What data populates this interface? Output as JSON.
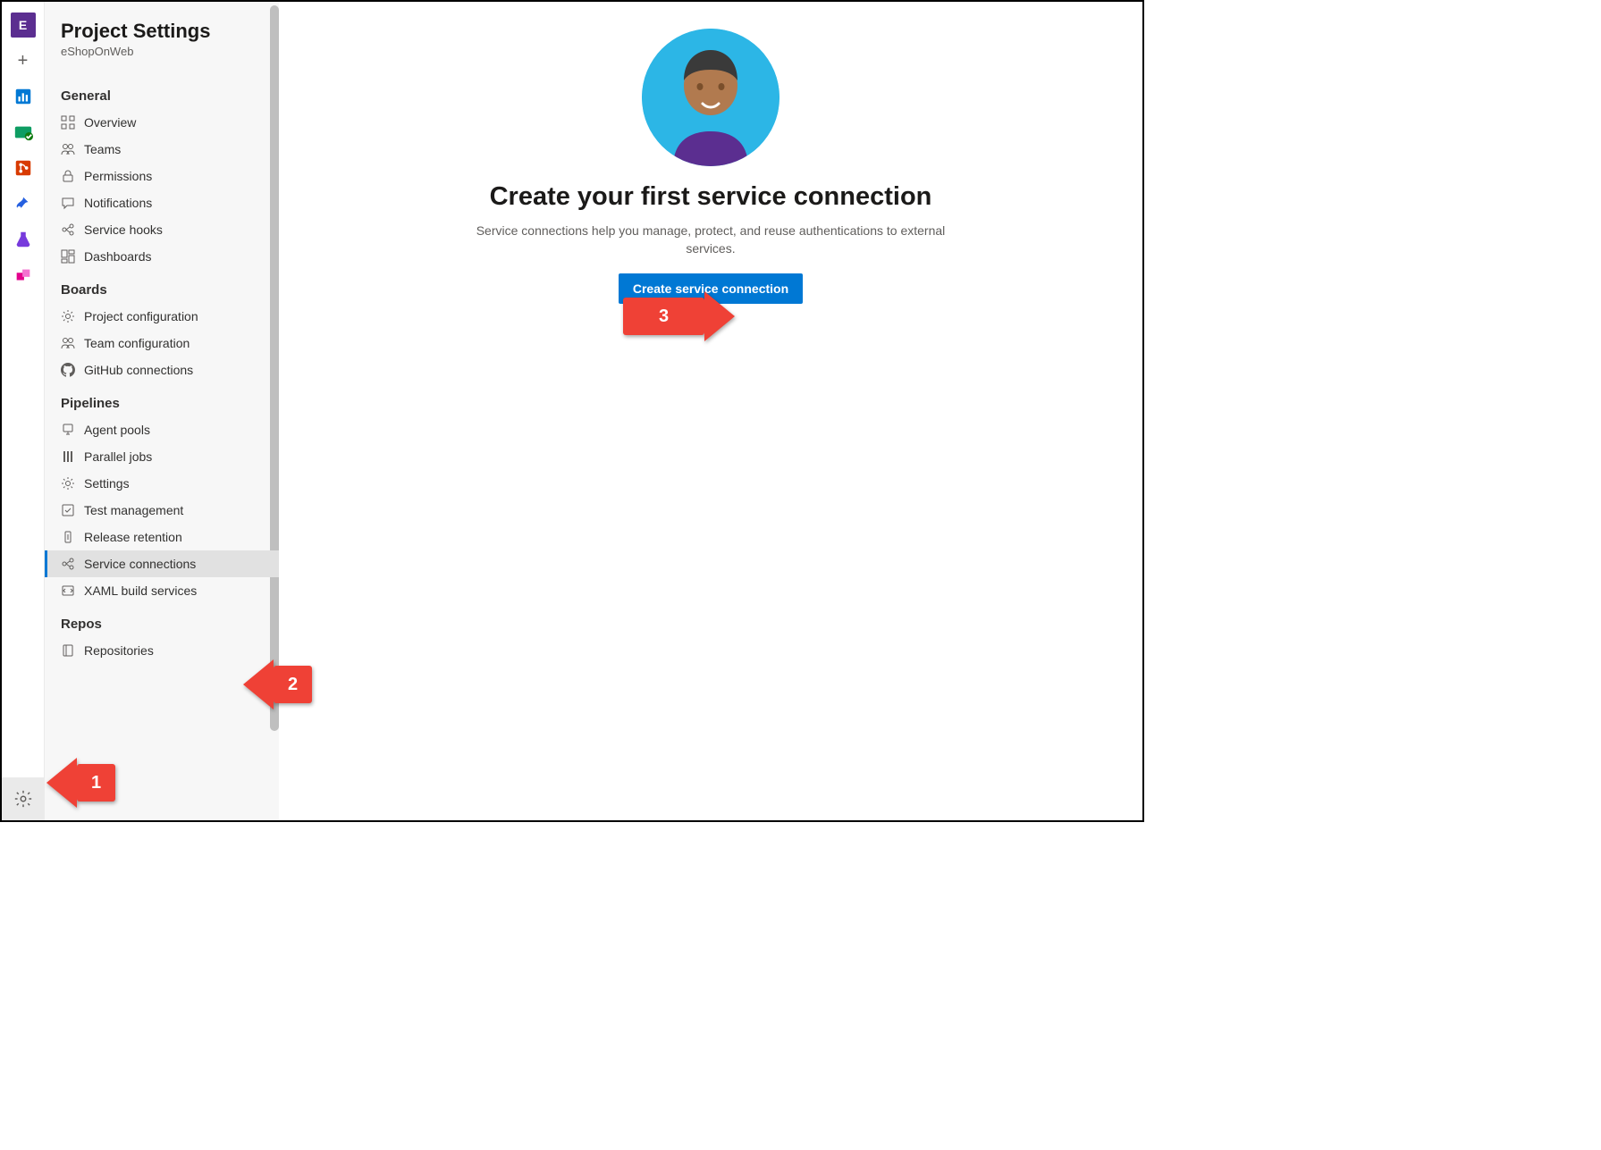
{
  "rail": {
    "project_initial": "E",
    "items": [
      {
        "name": "overview",
        "color": "#0078d4"
      },
      {
        "name": "boards",
        "color": "#107c10"
      },
      {
        "name": "repos",
        "color": "#d83b01"
      },
      {
        "name": "pipelines",
        "color": "#2560e0"
      },
      {
        "name": "test-plans",
        "color": "#773adc"
      },
      {
        "name": "artifacts",
        "color": "#e3008c"
      }
    ]
  },
  "settings": {
    "title": "Project Settings",
    "subtitle": "eShopOnWeb",
    "sections": [
      {
        "title": "General",
        "items": [
          {
            "label": "Overview",
            "icon": "grid"
          },
          {
            "label": "Teams",
            "icon": "teams"
          },
          {
            "label": "Permissions",
            "icon": "lock"
          },
          {
            "label": "Notifications",
            "icon": "chat"
          },
          {
            "label": "Service hooks",
            "icon": "hook"
          },
          {
            "label": "Dashboards",
            "icon": "dashboard"
          }
        ]
      },
      {
        "title": "Boards",
        "items": [
          {
            "label": "Project configuration",
            "icon": "gear2"
          },
          {
            "label": "Team configuration",
            "icon": "teams"
          },
          {
            "label": "GitHub connections",
            "icon": "github"
          }
        ]
      },
      {
        "title": "Pipelines",
        "items": [
          {
            "label": "Agent pools",
            "icon": "agent"
          },
          {
            "label": "Parallel jobs",
            "icon": "parallel"
          },
          {
            "label": "Settings",
            "icon": "gear"
          },
          {
            "label": "Test management",
            "icon": "test"
          },
          {
            "label": "Release retention",
            "icon": "release"
          },
          {
            "label": "Service connections",
            "icon": "hook",
            "selected": true
          },
          {
            "label": "XAML build services",
            "icon": "xaml"
          }
        ]
      },
      {
        "title": "Repos",
        "items": [
          {
            "label": "Repositories",
            "icon": "repo"
          }
        ]
      }
    ]
  },
  "main": {
    "heading": "Create your first service connection",
    "description": "Service connections help you manage, protect, and reuse authentications to external services.",
    "button": "Create service connection"
  },
  "annotations": {
    "step1": "1",
    "step2": "2",
    "step3": "3"
  }
}
